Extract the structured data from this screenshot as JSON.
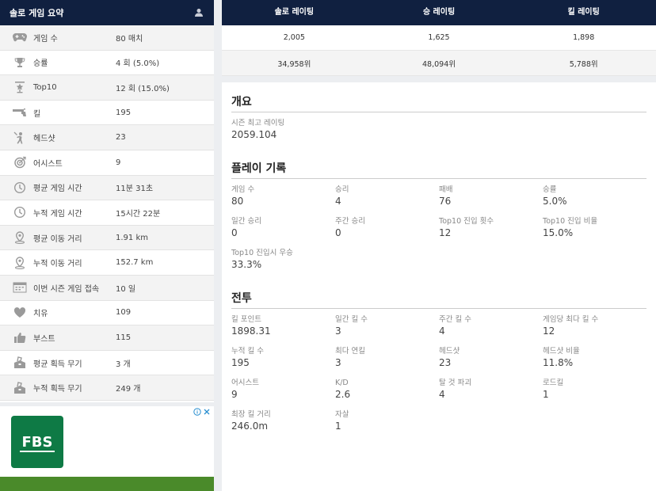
{
  "summary": {
    "title": "솔로 게임 요약",
    "rows": [
      {
        "icon": "gamepad-icon",
        "label": "게임 수",
        "value": "80 매치"
      },
      {
        "icon": "trophy-icon",
        "label": "승률",
        "value": "4 회 (5.0%)"
      },
      {
        "icon": "top10-icon",
        "label": "Top10",
        "value": "12 회 (15.0%)"
      },
      {
        "icon": "gun-icon",
        "label": "킬",
        "value": "195"
      },
      {
        "icon": "headshot-icon",
        "label": "헤드샷",
        "value": "23"
      },
      {
        "icon": "target-icon",
        "label": "어시스트",
        "value": "9"
      },
      {
        "icon": "clock-icon",
        "label": "평균 게임 시간",
        "value": "11분 31초"
      },
      {
        "icon": "clock-icon",
        "label": "누적 게임 시간",
        "value": "15시간 22분"
      },
      {
        "icon": "location-icon",
        "label": "평균 이동 거리",
        "value": "1.91 km"
      },
      {
        "icon": "location-icon",
        "label": "누적 이동 거리",
        "value": "152.7 km"
      },
      {
        "icon": "calendar-icon",
        "label": "이번 시즌 게임 접속",
        "value": "10 일"
      },
      {
        "icon": "heart-icon",
        "label": "치유",
        "value": "109"
      },
      {
        "icon": "thumbs-up-icon",
        "label": "부스트",
        "value": "115"
      },
      {
        "icon": "crate-icon",
        "label": "평균 획득 무기",
        "value": "3 개"
      },
      {
        "icon": "crate-icon",
        "label": "누적 획득 무기",
        "value": "249 개"
      }
    ]
  },
  "ad": {
    "logo_text": "FBS"
  },
  "ratings": {
    "headers": [
      "솔로 레이팅",
      "승 레이팅",
      "킬 레이팅"
    ],
    "values": [
      "2,005",
      "1,625",
      "1,898"
    ],
    "ranks": [
      "34,958위",
      "48,094위",
      "5,788위"
    ]
  },
  "overview": {
    "title": "개요",
    "items": [
      {
        "label": "시즌 최고 레이팅",
        "value": "2059.104"
      }
    ]
  },
  "records": {
    "title": "플레이 기록",
    "items": [
      {
        "label": "게임 수",
        "value": "80"
      },
      {
        "label": "승리",
        "value": "4"
      },
      {
        "label": "패배",
        "value": "76"
      },
      {
        "label": "승률",
        "value": "5.0%"
      },
      {
        "label": "일간 승리",
        "value": "0"
      },
      {
        "label": "주간 승리",
        "value": "0"
      },
      {
        "label": "Top10 진입 횟수",
        "value": "12"
      },
      {
        "label": "Top10 진입 비율",
        "value": "15.0%"
      },
      {
        "label": "Top10 진입시 우승",
        "value": "33.3%"
      }
    ]
  },
  "combat": {
    "title": "전투",
    "items": [
      {
        "label": "킬 포인트",
        "value": "1898.31"
      },
      {
        "label": "일간 킬 수",
        "value": "3"
      },
      {
        "label": "주간 킬 수",
        "value": "4"
      },
      {
        "label": "게임당 최다 킬 수",
        "value": "12"
      },
      {
        "label": "누적 킬 수",
        "value": "195"
      },
      {
        "label": "최다 연킬",
        "value": "3"
      },
      {
        "label": "헤드샷",
        "value": "23"
      },
      {
        "label": "헤드샷 비율",
        "value": "11.8%"
      },
      {
        "label": "어시스트",
        "value": "9"
      },
      {
        "label": "K/D",
        "value": "2.6"
      },
      {
        "label": "탈 것 파괴",
        "value": "4"
      },
      {
        "label": "로드킬",
        "value": "1"
      },
      {
        "label": "최장 킬 거리",
        "value": "246.0m"
      },
      {
        "label": "자살",
        "value": "1"
      }
    ]
  }
}
